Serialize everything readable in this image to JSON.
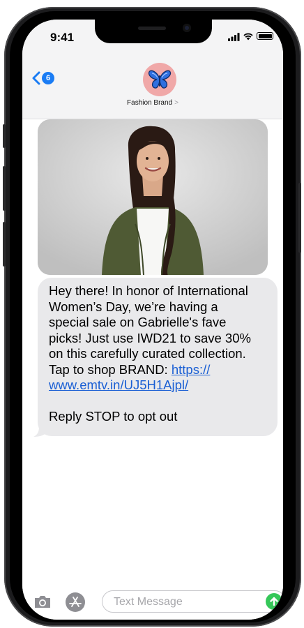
{
  "status_bar": {
    "time": "9:41"
  },
  "header": {
    "back_badge": "6",
    "contact_name": "Fashion Brand",
    "chevron": ">",
    "avatar_icon": "butterfly-icon"
  },
  "message": {
    "image_alt": "woman-in-green-cardigan-photo",
    "text_lines": [
      "Hey there! In honor of International",
      "Women’s Day, we’re having a",
      "special sale on Gabrielle's fave",
      "picks! Just use IWD21 to save 30%",
      "on this carefully curated collection.",
      "Tap to shop BRAND: "
    ],
    "link_part1": "https://",
    "link_part2": "www.emtv.in/UJ5H1Ajpl/",
    "opt_out": "Reply STOP to opt out"
  },
  "compose": {
    "placeholder": "Text Message",
    "value": ""
  },
  "colors": {
    "accent": "#1a7cf4",
    "bubble": "#e9e9eb",
    "link": "#1a5fd4",
    "send": "#35c759",
    "avatar_bg": "#f0a8a8"
  }
}
